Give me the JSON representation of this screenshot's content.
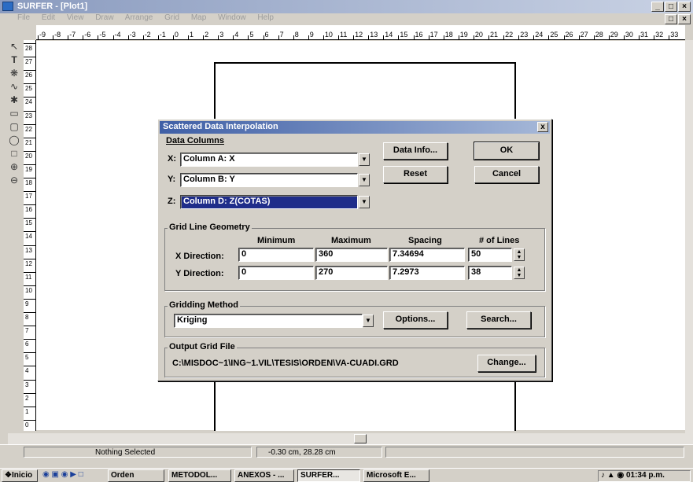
{
  "window": {
    "title": "SURFER - [Plot1]",
    "min_label": "_",
    "max_label": "□",
    "close_label": "×"
  },
  "menu": [
    "File",
    "Edit",
    "View",
    "Draw",
    "Arrange",
    "Grid",
    "Map",
    "Window",
    "Help"
  ],
  "ruler_h_ticks": [
    "-9",
    "-8",
    "-7",
    "-6",
    "-5",
    "-4",
    "-3",
    "-2",
    "-1",
    "0",
    "1",
    "2",
    "3",
    "4",
    "5",
    "6",
    "7",
    "8",
    "9",
    "10",
    "11",
    "12",
    "13",
    "14",
    "15",
    "16",
    "17",
    "18",
    "19",
    "20",
    "21",
    "22",
    "23",
    "24",
    "25",
    "26",
    "27",
    "28",
    "29",
    "30",
    "31",
    "32",
    "33"
  ],
  "ruler_v_ticks": [
    "28",
    "27",
    "26",
    "25",
    "24",
    "23",
    "22",
    "21",
    "20",
    "19",
    "18",
    "17",
    "16",
    "15",
    "14",
    "13",
    "12",
    "11",
    "10",
    "9",
    "8",
    "7",
    "6",
    "5",
    "4",
    "3",
    "2",
    "1",
    "0"
  ],
  "dialog": {
    "title": "Scattered Data Interpolation",
    "close_label": "x",
    "data_columns_label": "Data Columns",
    "x_label": "X:",
    "x_value": "Column A:  X",
    "y_label": "Y:",
    "y_value": "Column B:  Y",
    "z_label": "Z:",
    "z_value": "Column D:  Z(COTAS)",
    "data_info_button": "Data Info...",
    "ok_button": "OK",
    "reset_button": "Reset",
    "cancel_button": "Cancel",
    "grid_geometry_label": "Grid Line Geometry",
    "col_minimum": "Minimum",
    "col_maximum": "Maximum",
    "col_spacing": "Spacing",
    "col_lines": "# of Lines",
    "x_direction_label": "X Direction:",
    "x_min": "0",
    "x_max": "360",
    "x_spacing": "7.34694",
    "x_lines": "50",
    "y_direction_label": "Y Direction:",
    "y_min": "0",
    "y_max": "270",
    "y_spacing": "7.2973",
    "y_lines": "38",
    "gridding_method_label": "Gridding Method",
    "gridding_method_value": "Kriging",
    "options_button": "Options...",
    "search_button": "Search...",
    "output_grid_label": "Output Grid File",
    "output_path": "C:\\MISDOC~1\\ING~1.VIL\\TESIS\\ORDEN\\VA-CUADI.GRD",
    "change_button": "Change..."
  },
  "status": {
    "selection": "Nothing Selected",
    "coords": "-0.30 cm, 28.28 cm"
  },
  "taskbar": {
    "start": "Inicio",
    "items": [
      "Orden",
      "METODOL...",
      "ANEXOS - ...",
      "SURFER...",
      "Microsoft E..."
    ],
    "clock": "01:34 p.m."
  }
}
